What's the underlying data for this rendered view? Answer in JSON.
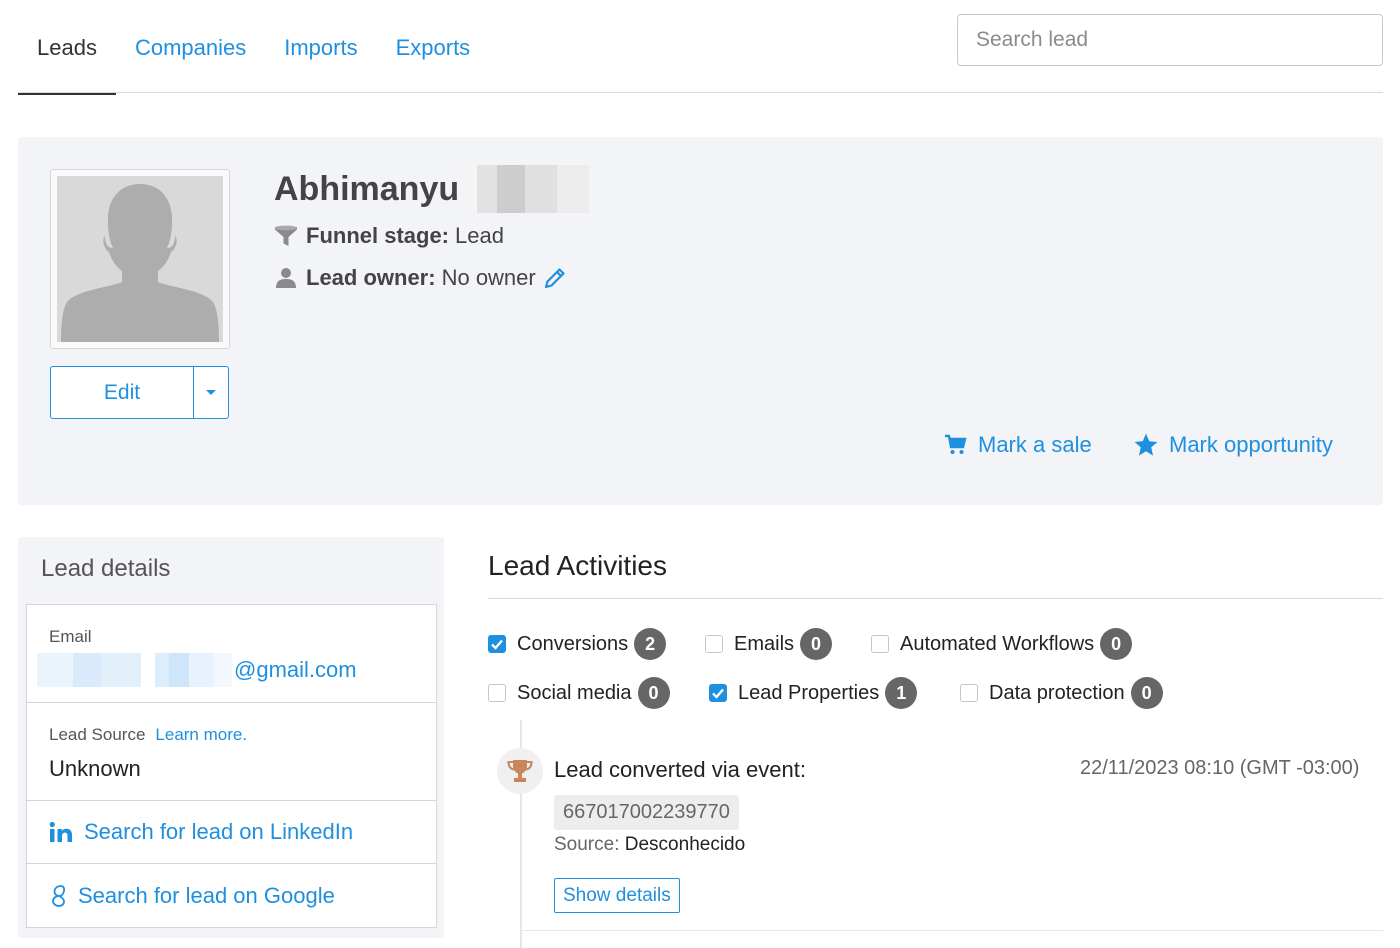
{
  "nav": {
    "tabs": [
      {
        "label": "Leads",
        "active": true
      },
      {
        "label": "Companies",
        "active": false
      },
      {
        "label": "Imports",
        "active": false
      },
      {
        "label": "Exports",
        "active": false
      }
    ],
    "search_placeholder": "Search lead"
  },
  "lead": {
    "name": "Abhimanyu",
    "funnel_stage_label": "Funnel stage:",
    "funnel_stage_value": "Lead",
    "owner_label": "Lead owner:",
    "owner_value": "No owner",
    "edit_label": "Edit",
    "mark_sale": "Mark a sale",
    "mark_opportunity": "Mark opportunity"
  },
  "details": {
    "title": "Lead details",
    "email_label": "Email",
    "email_domain": "@gmail.com",
    "source_label": "Lead Source",
    "learn_more": "Learn more.",
    "source_value": "Unknown",
    "linkedin_search": "Search for lead on LinkedIn",
    "google_search": "Search for lead on Google"
  },
  "activities": {
    "title": "Lead Activities",
    "filters": [
      {
        "label": "Conversions",
        "count": "2",
        "checked": true
      },
      {
        "label": "Emails",
        "count": "0",
        "checked": false
      },
      {
        "label": "Automated Workflows",
        "count": "0",
        "checked": false
      },
      {
        "label": "Social media",
        "count": "0",
        "checked": false
      },
      {
        "label": "Lead Properties",
        "count": "1",
        "checked": true
      },
      {
        "label": "Data protection",
        "count": "0",
        "checked": false
      }
    ],
    "event": {
      "title": "Lead converted via event:",
      "timestamp": "22/11/2023 08:10 (GMT -03:00)",
      "id": "667017002239770",
      "source_label": "Source:",
      "source_value": "Desconhecido",
      "show_details": "Show details"
    }
  },
  "colors": {
    "accent": "#1f8fe0",
    "panel_bg": "#f2f4f7",
    "badge_bg": "#666666",
    "trophy": "#c8865a"
  }
}
